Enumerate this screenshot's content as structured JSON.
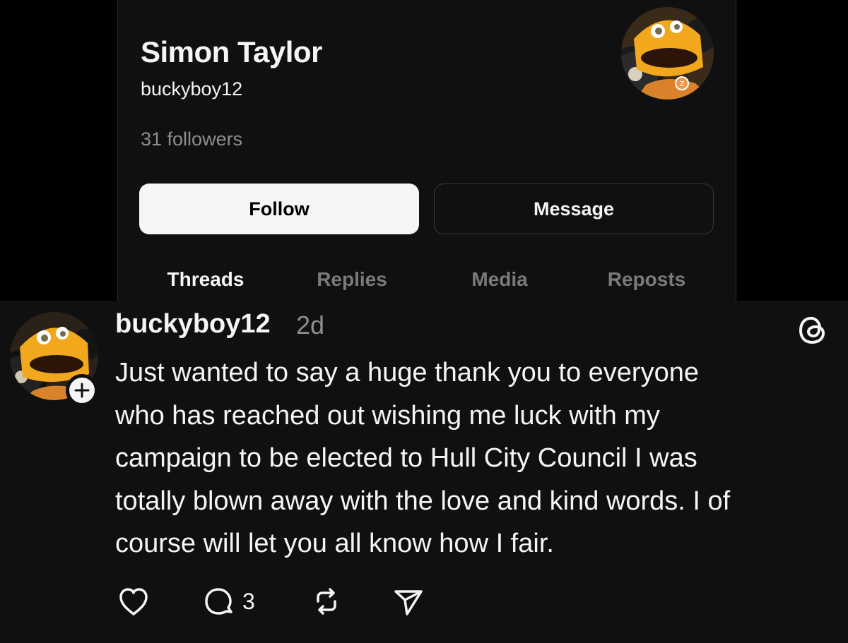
{
  "profile": {
    "name": "Simon Taylor",
    "handle": "buckyboy12",
    "followers": "31 followers",
    "follow_label": "Follow",
    "message_label": "Message",
    "tabs": [
      {
        "label": "Threads",
        "active": true
      },
      {
        "label": "Replies",
        "active": false
      },
      {
        "label": "Media",
        "active": false
      },
      {
        "label": "Reposts",
        "active": false
      }
    ],
    "avatar_icon": "zippy-puppet-avatar"
  },
  "post": {
    "username": "buckyboy12",
    "time": "2d",
    "avatar_icon": "zippy-puppet-avatar",
    "follow_badge_icon": "plus-icon",
    "app_icon": "threads-logo-icon",
    "text_lines": [
      "Just wanted to say a huge thank you to everyone",
      "who has reached out wishing me luck with my",
      "campaign to be elected to Hull City Council I was",
      "totally blown away with the love and kind words. I of",
      "course will let you all know how I fair."
    ],
    "actions": {
      "like_icon": "heart-icon",
      "reply_icon": "comment-icon",
      "reply_count": "3",
      "repost_icon": "repost-icon",
      "share_icon": "send-icon"
    }
  },
  "colors": {
    "background": "#101010",
    "text": "#f3f5f7",
    "muted": "#8e8e8e",
    "follow_button": "#f3f5f7"
  }
}
